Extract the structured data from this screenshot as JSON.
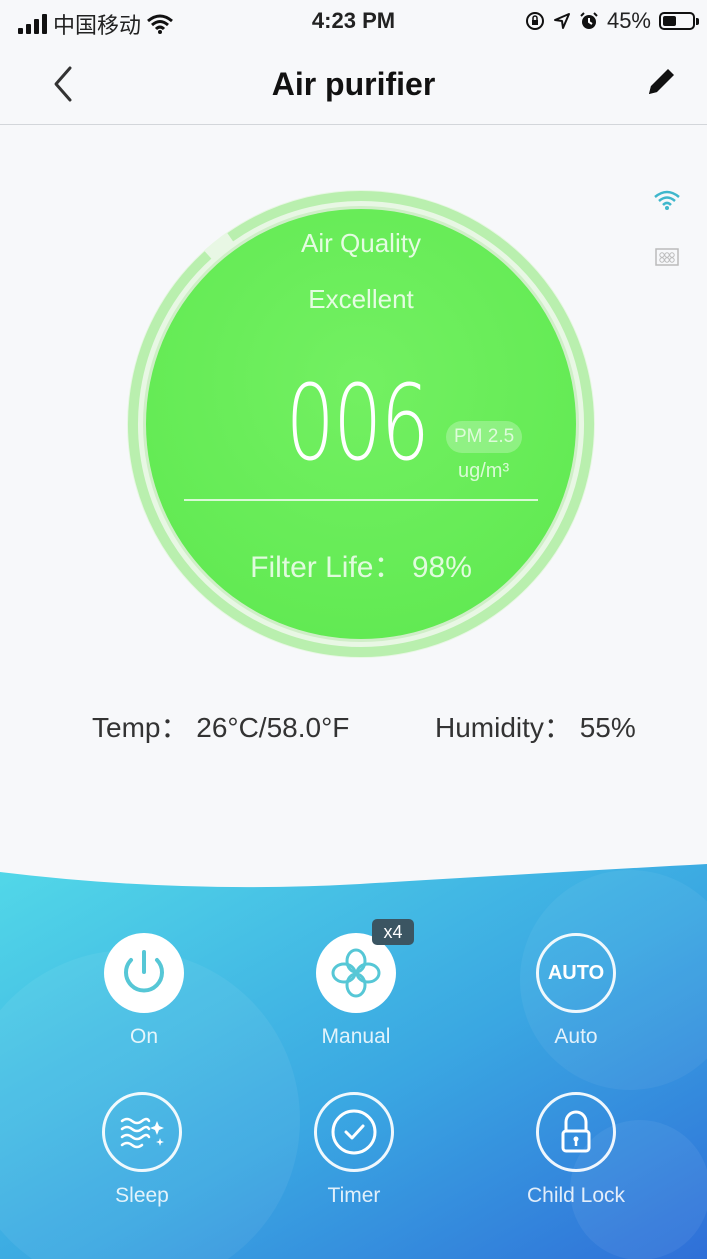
{
  "status_bar": {
    "carrier": "中国移动",
    "time": "4:23 PM",
    "battery": "45%",
    "battery_level": 0.45,
    "icons": [
      "signal-icon",
      "wifi-icon",
      "orientation-lock-icon",
      "location-icon",
      "alarm-icon",
      "battery-icon"
    ]
  },
  "nav": {
    "title": "Air purifier",
    "back_icon": "chevron-left-icon",
    "edit_icon": "pencil-icon"
  },
  "indicators": {
    "wifi": "wifi-icon",
    "filter": "filter-icon"
  },
  "gauge": {
    "air_quality_label": "Air Quality",
    "air_quality_status": "Excellent",
    "pm_value": "006",
    "pm_label": "PM 2.5",
    "pm_unit": "ug/m³",
    "filter_life_text": "Filter Life： 98%",
    "filter_life_level": 0.98,
    "color": "#6fef5c"
  },
  "environment": {
    "temp_text": "Temp： 26°C/58.0°F",
    "humidity_text": "Humidity： 55%"
  },
  "controls": {
    "on": {
      "label": "On",
      "icon": "power-icon"
    },
    "manual": {
      "label": "Manual",
      "icon": "fan-icon",
      "speed_badge": "x4"
    },
    "auto": {
      "label": "Auto",
      "icon_text": "AUTO"
    },
    "sleep": {
      "label": "Sleep",
      "icon": "sleep-icon"
    },
    "timer": {
      "label": "Timer",
      "icon": "clock-icon"
    },
    "child_lock": {
      "label": "Child Lock",
      "icon": "lock-icon"
    },
    "accent": "#3fb7cc"
  }
}
